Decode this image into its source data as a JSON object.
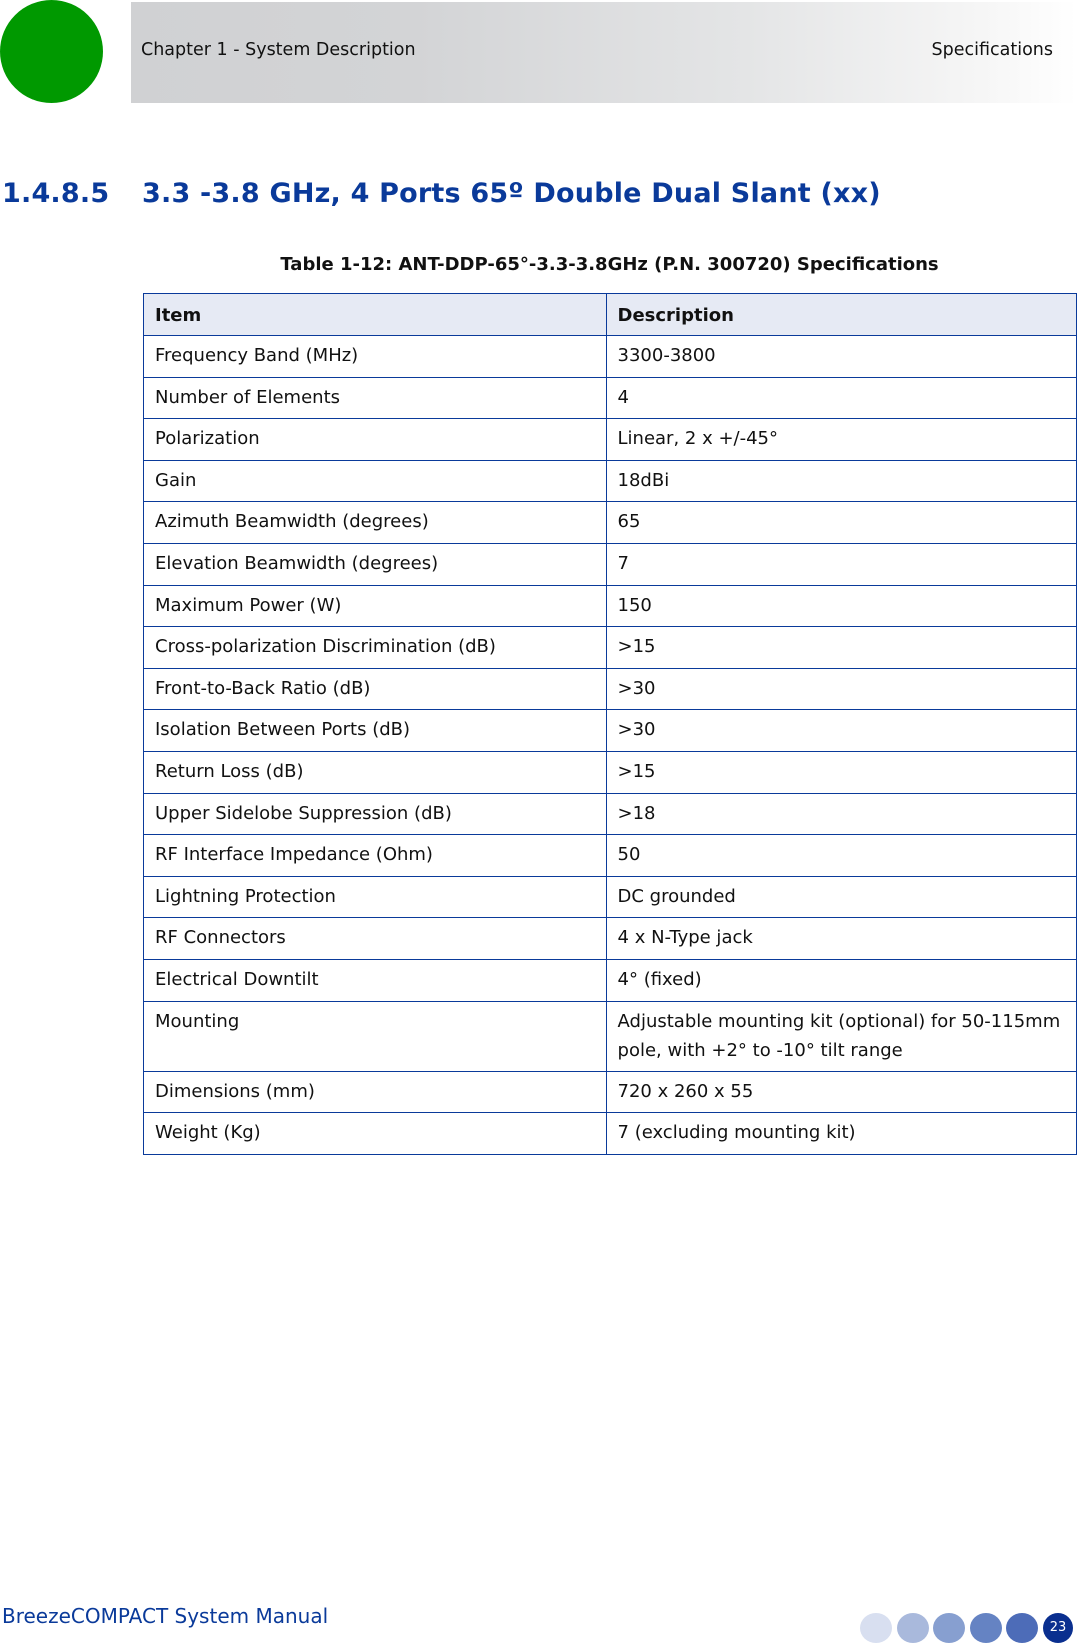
{
  "header": {
    "chapter": "Chapter 1 - System Description",
    "section": "Specifications",
    "accent_circle_color": "#009900"
  },
  "heading": {
    "number": "1.4.8.5",
    "title": "3.3 -3.8 GHz, 4 Ports 65º Double Dual Slant (xx)"
  },
  "table": {
    "caption": "Table 1-12: ANT-DDP-65°-3.3-3.8GHz (P.N. 300720) Specifications",
    "columns": [
      "Item",
      "Description"
    ],
    "rows": [
      {
        "item": "Frequency Band (MHz)",
        "description": "3300-3800"
      },
      {
        "item": "Number of Elements",
        "description": "4"
      },
      {
        "item": "Polarization",
        "description": "Linear, 2 x +/-45°"
      },
      {
        "item": "Gain",
        "description": "18dBi"
      },
      {
        "item": "Azimuth Beamwidth (degrees)",
        "description": "65"
      },
      {
        "item": "Elevation Beamwidth (degrees)",
        "description": "7"
      },
      {
        "item": "Maximum Power (W)",
        "description": "150"
      },
      {
        "item": "Cross-polarization Discrimination (dB)",
        "description": ">15"
      },
      {
        "item": "Front-to-Back Ratio (dB)",
        "description": ">30"
      },
      {
        "item": "Isolation Between Ports (dB)",
        "description": ">30"
      },
      {
        "item": "Return Loss (dB)",
        "description": ">15"
      },
      {
        "item": "Upper Sidelobe Suppression (dB)",
        "description": ">18"
      },
      {
        "item": "RF Interface Impedance (Ohm)",
        "description": "50"
      },
      {
        "item": "Lightning Protection",
        "description": "DC grounded"
      },
      {
        "item": "RF Connectors",
        "description": "4 x N-Type jack"
      },
      {
        "item": "Electrical Downtilt",
        "description": "4° (fixed)"
      },
      {
        "item": "Mounting",
        "description": "Adjustable mounting kit (optional) for 50-115mm pole, with +2° to -10° tilt range"
      },
      {
        "item": "Dimensions (mm)",
        "description": "720 x 260 x 55"
      },
      {
        "item": "Weight (Kg)",
        "description": "7 (excluding mounting kit)"
      }
    ]
  },
  "footer": {
    "manual_title": "BreezeCOMPACT System Manual",
    "page_number": "23",
    "dot_colors": [
      "#d8dff0",
      "#a9b9dc",
      "#879fd0",
      "#6583c3",
      "#4d6cb8"
    ],
    "page_dot_color": "#0a2f8f"
  }
}
